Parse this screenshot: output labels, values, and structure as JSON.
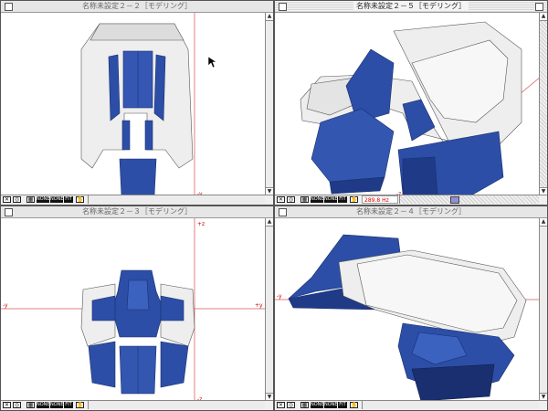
{
  "windows": {
    "top_left": {
      "title": "名称未設定２－２［モデリング］"
    },
    "top_right": {
      "title": "名称未設定２－５［モデリング］"
    },
    "bottom_left": {
      "title": "名称未設定２－３［モデリング］"
    },
    "bottom_right": {
      "title": "名称未設定２－４［モデリング］"
    }
  },
  "toolbar": {
    "none_label_1": "NONE",
    "none_label_2": "NONE",
    "fit_label": "FIT"
  },
  "coordinate_readout": "289.8 Hz",
  "axis_labels": {
    "tl_bottom": "-y",
    "bl_top": "+z",
    "bl_bottom": "-z",
    "bl_left": "-y",
    "bl_right": "+y",
    "br_left": "-y",
    "tr_bottom": "-z"
  },
  "colors": {
    "model_blue": "#2c4ea6",
    "model_blue_dark": "#1a2f70",
    "model_white": "#eeeeee",
    "axis_red": "#e06060",
    "desktop": "#8a8a8a"
  }
}
